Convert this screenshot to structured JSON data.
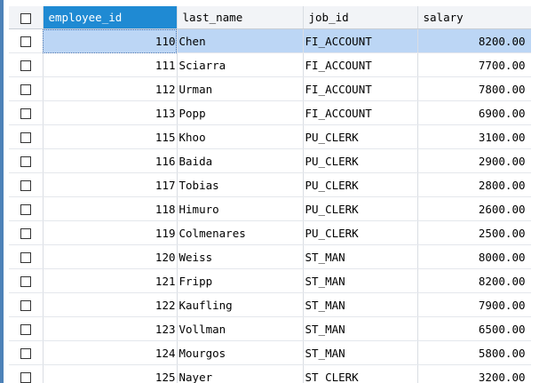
{
  "grid": {
    "columns": [
      "employee_id",
      "last_name",
      "job_id",
      "salary"
    ],
    "selected_row": 0,
    "rows": [
      {
        "employee_id": "110",
        "last_name": "Chen",
        "job_id": "FI_ACCOUNT",
        "salary": "8200.00"
      },
      {
        "employee_id": "111",
        "last_name": "Sciarra",
        "job_id": "FI_ACCOUNT",
        "salary": "7700.00"
      },
      {
        "employee_id": "112",
        "last_name": "Urman",
        "job_id": "FI_ACCOUNT",
        "salary": "7800.00"
      },
      {
        "employee_id": "113",
        "last_name": "Popp",
        "job_id": "FI_ACCOUNT",
        "salary": "6900.00"
      },
      {
        "employee_id": "115",
        "last_name": "Khoo",
        "job_id": "PU_CLERK",
        "salary": "3100.00"
      },
      {
        "employee_id": "116",
        "last_name": "Baida",
        "job_id": "PU_CLERK",
        "salary": "2900.00"
      },
      {
        "employee_id": "117",
        "last_name": "Tobias",
        "job_id": "PU_CLERK",
        "salary": "2800.00"
      },
      {
        "employee_id": "118",
        "last_name": "Himuro",
        "job_id": "PU_CLERK",
        "salary": "2600.00"
      },
      {
        "employee_id": "119",
        "last_name": "Colmenares",
        "job_id": "PU_CLERK",
        "salary": "2500.00"
      },
      {
        "employee_id": "120",
        "last_name": "Weiss",
        "job_id": "ST_MAN",
        "salary": "8000.00"
      },
      {
        "employee_id": "121",
        "last_name": "Fripp",
        "job_id": "ST_MAN",
        "salary": "8200.00"
      },
      {
        "employee_id": "122",
        "last_name": "Kaufling",
        "job_id": "ST_MAN",
        "salary": "7900.00"
      },
      {
        "employee_id": "123",
        "last_name": "Vollman",
        "job_id": "ST_MAN",
        "salary": "6500.00"
      },
      {
        "employee_id": "124",
        "last_name": "Mourgos",
        "job_id": "ST_MAN",
        "salary": "5800.00"
      },
      {
        "employee_id": "125",
        "last_name": "Nayer",
        "job_id": "ST_CLERK",
        "salary": "3200.00"
      }
    ]
  },
  "colors": {
    "header_accent": "#1f8ad3",
    "selection": "#bcd6f5",
    "left_accent": "#4d82b8"
  }
}
